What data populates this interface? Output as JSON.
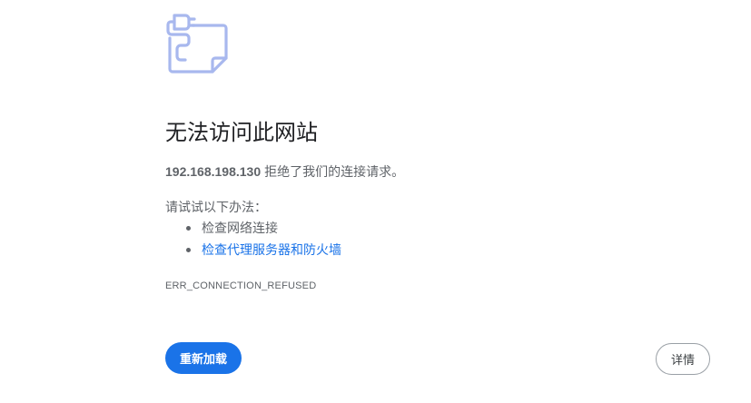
{
  "icon": {
    "name": "unplugged-page-icon",
    "color": "#a8b8ee"
  },
  "title": "无法访问此网站",
  "message": {
    "host": "192.168.198.130",
    "text": "拒绝了我们的连接请求。"
  },
  "suggestions": {
    "label": "请试试以下办法：",
    "items": [
      {
        "label": "检查网络连接"
      },
      {
        "label": "检查代理服务器和防火墙"
      }
    ]
  },
  "error_code": "ERR_CONNECTION_REFUSED",
  "buttons": {
    "reload": "重新加载",
    "details": "详情"
  },
  "colors": {
    "accent": "#1a73e8",
    "title": "#202124",
    "text": "#5f6368"
  }
}
